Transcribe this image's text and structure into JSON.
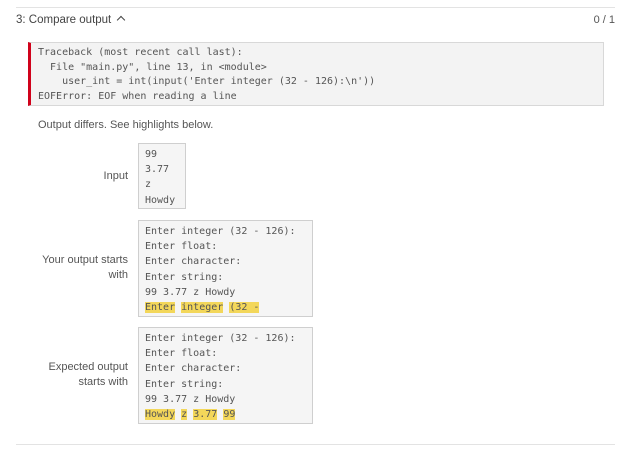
{
  "header": {
    "title": "3: Compare output",
    "score": "0 / 1"
  },
  "traceback": [
    "Traceback (most recent call last):",
    "  File \"main.py\", line 13, in <module>",
    "    user_int = int(input('Enter integer (32 - 126):\\n'))",
    "EOFError: EOF when reading a line"
  ],
  "diff_message": "Output differs. See highlights below.",
  "input": {
    "label": "Input",
    "lines": [
      "99",
      "3.77",
      "z",
      "Howdy"
    ]
  },
  "your_output": {
    "label_line1": "Your output starts",
    "label_line2": "with",
    "lines": [
      "Enter integer (32 - 126):",
      "Enter float:",
      "Enter character:",
      "Enter string:",
      "99 3.77 z Howdy"
    ],
    "highlight_tokens": [
      "Enter",
      "integer",
      "(32 -"
    ]
  },
  "expected_output": {
    "label_line1": "Expected output",
    "label_line2": "starts with",
    "lines": [
      "Enter integer (32 - 126):",
      "Enter float:",
      "Enter character:",
      "Enter string:",
      "99 3.77 z Howdy"
    ],
    "highlight_tokens": [
      "Howdy",
      "z",
      "3.77",
      "99"
    ]
  },
  "colors": {
    "highlight": "#f3d75a",
    "error_bar": "#d0021b"
  }
}
